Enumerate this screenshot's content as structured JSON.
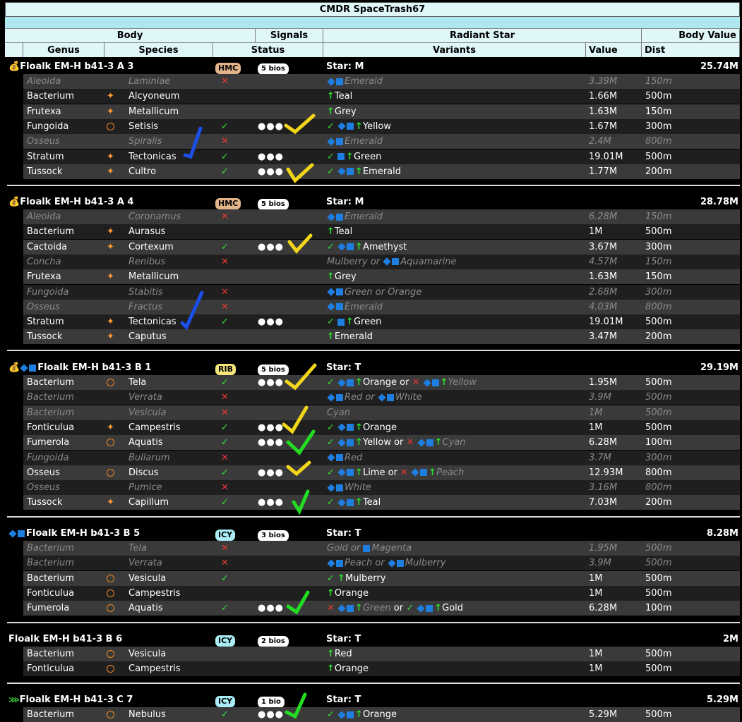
{
  "title": "CMDR SpaceTrash67",
  "group_headers": {
    "body": "Body",
    "signals": "Signals",
    "radiant": "Radiant Star",
    "value": "Body Value"
  },
  "col_headers": {
    "genus": "Genus",
    "species": "Species",
    "status": "Status",
    "variants": "Variants",
    "value": "Value",
    "dist": "Dist"
  },
  "sections": [
    {
      "name": "Floalk EM-H b41-3 A 3",
      "type": "HMC",
      "bios": "5 bios",
      "star": "Star: M",
      "value": "25.74M"
    },
    {
      "name": "Floalk EM-H b41-3 A 4",
      "type": "HMC",
      "bios": "5 bios",
      "star": "Star: M",
      "value": "28.78M"
    },
    {
      "name": "Floalk EM-H b41-3 B 1",
      "type": "RIB",
      "bios": "5 bios",
      "star": "Star: T",
      "value": "29.19M"
    },
    {
      "name": "Floalk EM-H b41-3 B 5",
      "type": "ICY",
      "bios": "3 bios",
      "star": "Star: T",
      "value": "8.28M"
    },
    {
      "name": "Floalk EM-H b41-3 B 6",
      "type": "ICY",
      "bios": "2 bios",
      "star": "Star: T",
      "value": "2M"
    },
    {
      "name": "Floalk EM-H b41-3 C 7",
      "type": "ICY",
      "bios": "1 bio",
      "star": "Star: T",
      "value": "5.29M"
    }
  ],
  "rows": [
    [
      "Aleoida",
      "Laminiae",
      "Emerald",
      "3.39M",
      "150m"
    ],
    [
      "Bacterium",
      "Alcyoneum",
      "Teal",
      "1.66M",
      "500m"
    ],
    [
      "Frutexa",
      "Metallicum",
      "Grey",
      "1.63M",
      "150m"
    ],
    [
      "Fungoida",
      "Setisis",
      "Yellow",
      "1.67M",
      "300m"
    ],
    [
      "Osseus",
      "Spiralis",
      "Emerald",
      "2.4M",
      "800m"
    ],
    [
      "Stratum",
      "Tectonicas",
      "Green",
      "19.01M",
      "500m"
    ],
    [
      "Tussock",
      "Cultro",
      "Emerald",
      "1.77M",
      "200m"
    ],
    [
      "Aleoida",
      "Coronamus",
      "Emerald",
      "6.28M",
      "150m"
    ],
    [
      "Bacterium",
      "Aurasus",
      "Teal",
      "1M",
      "500m"
    ],
    [
      "Cactoida",
      "Cortexum",
      "Amethyst",
      "3.67M",
      "300m"
    ],
    [
      "Concha",
      "Renibus",
      "Mulberry or",
      "4.57M",
      "150m",
      "Aquamarine"
    ],
    [
      "Frutexa",
      "Metallicum",
      "Grey",
      "1.63M",
      "150m"
    ],
    [
      "Fungoida",
      "Stabitis",
      "Green or Orange",
      "2.68M",
      "300m"
    ],
    [
      "Osseus",
      "Fractus",
      "Emerald",
      "4.03M",
      "800m"
    ],
    [
      "Stratum",
      "Tectonicas",
      "Green",
      "19.01M",
      "500m"
    ],
    [
      "Tussock",
      "Caputus",
      "Emerald",
      "3.47M",
      "200m"
    ],
    [
      "Bacterium",
      "Tela",
      "Orange or",
      "1.95M",
      "500m",
      "Yellow"
    ],
    [
      "Bacterium",
      "Verrata",
      "Red or",
      "3.9M",
      "500m",
      "White"
    ],
    [
      "Bacterium",
      "Vesicula",
      "Cyan",
      "1M",
      "500m"
    ],
    [
      "Fonticulua",
      "Campestris",
      "Orange",
      "1M",
      "500m"
    ],
    [
      "Fumerola",
      "Aquatis",
      "Yellow or",
      "6.28M",
      "100m",
      "Cyan"
    ],
    [
      "Fungoida",
      "Bullarum",
      "Red",
      "3.7M",
      "300m"
    ],
    [
      "Osseus",
      "Discus",
      "Lime or",
      "12.93M",
      "800m",
      "Peach"
    ],
    [
      "Osseus",
      "Pumice",
      "White",
      "3.16M",
      "800m"
    ],
    [
      "Tussock",
      "Capillum",
      "Teal",
      "7.03M",
      "200m"
    ],
    [
      "Bacterium",
      "Tela",
      "Gold or",
      "1.95M",
      "500m",
      "Magenta"
    ],
    [
      "Bacterium",
      "Verrata",
      "Peach or",
      "3.9M",
      "500m",
      "Mulberry"
    ],
    [
      "Bacterium",
      "Vesicula",
      "Mulberry",
      "1M",
      "500m"
    ],
    [
      "Fonticulua",
      "Campestris",
      "Orange",
      "1M",
      "500m"
    ],
    [
      "Fumerola",
      "Aquatis",
      "Green",
      "6.28M",
      "100m",
      "Gold"
    ],
    [
      "Bacterium",
      "Vesicula",
      "Red",
      "1M",
      "500m"
    ],
    [
      "Fonticulua",
      "Campestris",
      "Orange",
      "1M",
      "500m"
    ],
    [
      "Bacterium",
      "Nebulus",
      "Orange",
      "5.29M",
      "500m"
    ]
  ],
  "or_word": "or"
}
